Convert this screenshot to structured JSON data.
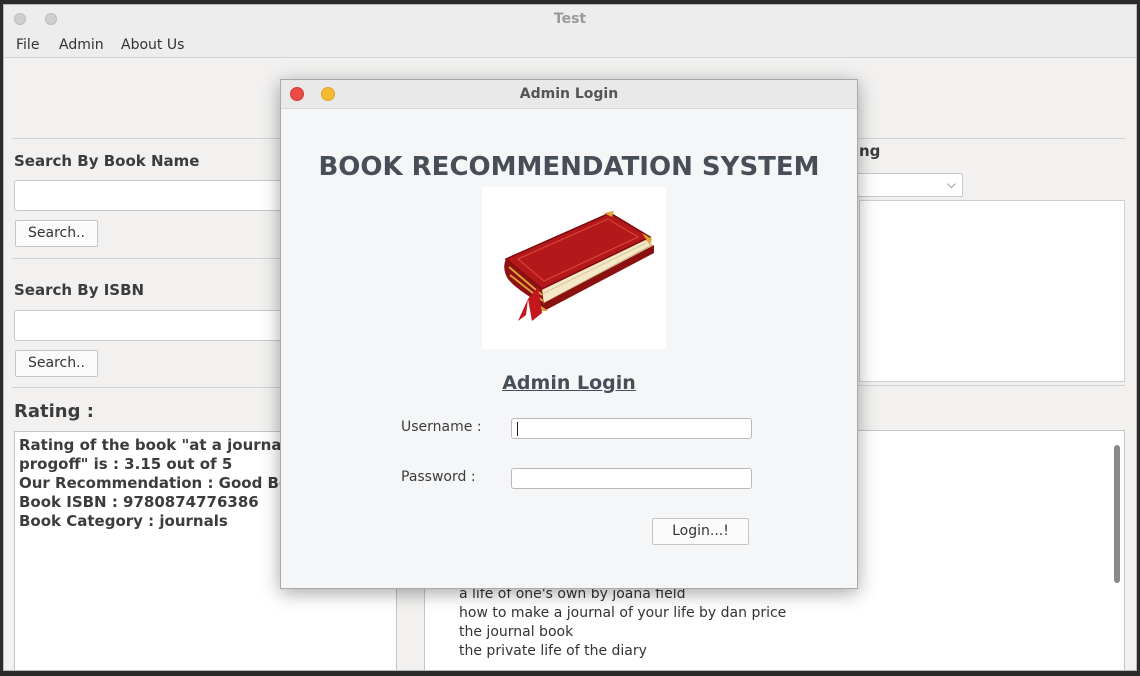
{
  "window": {
    "title": "Test"
  },
  "menu": {
    "items": [
      "File",
      "Admin",
      "About Us"
    ]
  },
  "search_name": {
    "label": "Search By  Book Name",
    "button": "Search.."
  },
  "search_isbn": {
    "label": "Search By ISBN",
    "button": "Search.."
  },
  "right_panel": {
    "partial_label": "ng"
  },
  "rating": {
    "title": "Rating :",
    "lines": [
      "Rating of the book \"at a journal wo",
      "progoff\"  is  :  3.15  out of 5",
      "Our Recommendation : Good Book",
      "Book ISBN : 9780874776386",
      "Book Category : journals"
    ]
  },
  "recommendations": {
    "lines": [
      "a life of one's own by joana field",
      "how to make a journal of your life by dan price",
      "the journal book",
      "the private life of the diary"
    ]
  },
  "dialog": {
    "title": "Admin Login",
    "app_heading": "BOOK RECOMMENDATION SYSTEM",
    "login_heading": "Admin Login",
    "username_label": "Username :",
    "password_label": "Password :",
    "username_value": "",
    "password_value": "",
    "login_button": "Login...!"
  },
  "icons": {
    "book": "book-icon"
  }
}
